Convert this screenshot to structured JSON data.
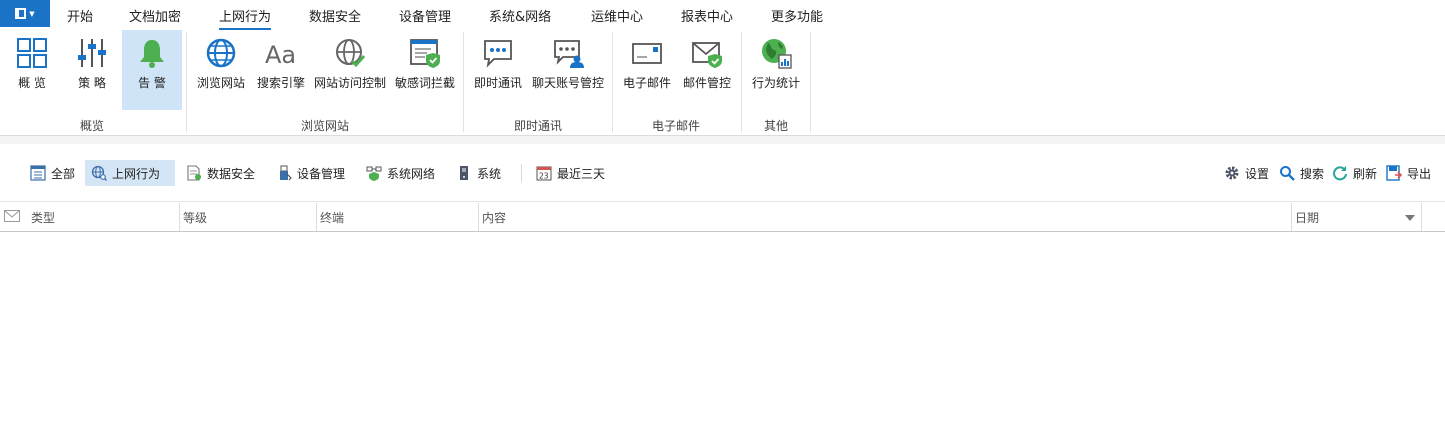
{
  "menu": {
    "items": [
      {
        "label": "开始"
      },
      {
        "label": "文档加密"
      },
      {
        "label": "上网行为",
        "active": true
      },
      {
        "label": "数据安全"
      },
      {
        "label": "设备管理"
      },
      {
        "label": "系统&网络"
      },
      {
        "label": "运维中心"
      },
      {
        "label": "报表中心"
      },
      {
        "label": "更多功能"
      }
    ]
  },
  "ribbon": {
    "groups": [
      {
        "label": "概览",
        "buttons": [
          {
            "label": "概 览",
            "icon": "overview-grid-icon"
          },
          {
            "label": "策 略",
            "icon": "policy-sliders-icon"
          },
          {
            "label": "告 警",
            "icon": "alert-bell-icon",
            "active": true
          }
        ]
      },
      {
        "label": "浏览网站",
        "buttons": [
          {
            "label": "浏览网站",
            "icon": "globe-icon"
          },
          {
            "label": "搜索引擎",
            "icon": "font-aa-icon"
          },
          {
            "label": "网站访问控制",
            "icon": "globe-check-icon"
          },
          {
            "label": "敏感词拦截",
            "icon": "document-shield-icon"
          }
        ]
      },
      {
        "label": "即时通讯",
        "buttons": [
          {
            "label": "即时通讯",
            "icon": "chat-bubble-icon"
          },
          {
            "label": "聊天账号管控",
            "icon": "chat-user-icon"
          }
        ]
      },
      {
        "label": "电子邮件",
        "buttons": [
          {
            "label": "电子邮件",
            "icon": "envelope-icon"
          },
          {
            "label": "邮件管控",
            "icon": "envelope-shield-icon"
          }
        ]
      },
      {
        "label": "其他",
        "buttons": [
          {
            "label": "行为统计",
            "icon": "globe-stats-icon"
          }
        ]
      }
    ]
  },
  "toolbar": {
    "filters": [
      {
        "label": "全部",
        "icon": "list-icon"
      },
      {
        "label": "上网行为",
        "icon": "globe-search-icon",
        "active": true
      },
      {
        "label": "数据安全",
        "icon": "data-doc-icon"
      },
      {
        "label": "设备管理",
        "icon": "usb-icon"
      },
      {
        "label": "系统网络",
        "icon": "network-shield-icon"
      },
      {
        "label": "系统",
        "icon": "server-icon"
      },
      {
        "label": "最近三天",
        "icon": "calendar-icon",
        "badge": "23"
      }
    ],
    "actions": [
      {
        "label": "设置",
        "icon": "gear-icon"
      },
      {
        "label": "搜索",
        "icon": "search-icon"
      },
      {
        "label": "刷新",
        "icon": "refresh-icon"
      },
      {
        "label": "导出",
        "icon": "export-icon"
      }
    ]
  },
  "table": {
    "columns": [
      {
        "label": "类型"
      },
      {
        "label": "等级"
      },
      {
        "label": "终端"
      },
      {
        "label": "内容"
      },
      {
        "label": "日期"
      }
    ],
    "rows": []
  },
  "colors": {
    "accent": "#1a73c7",
    "ribbon_active": "#cfe4f6",
    "alert_green": "#4caf50"
  }
}
